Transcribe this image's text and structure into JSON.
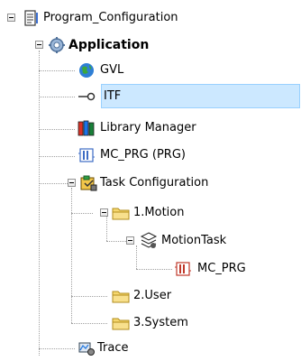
{
  "tree": {
    "root": {
      "label": "Program_Configuration"
    },
    "application": {
      "label": "Application"
    },
    "gvl": {
      "label": "GVL"
    },
    "itf": {
      "label": "ITF"
    },
    "library_manager": {
      "label": "Library Manager"
    },
    "mc_prg_prg": {
      "label": "MC_PRG (PRG)"
    },
    "task_configuration": {
      "label": "Task Configuration"
    },
    "motion_folder": {
      "label": "1.Motion"
    },
    "motion_task": {
      "label": "MotionTask"
    },
    "mc_prg_call": {
      "label": "MC_PRG"
    },
    "user_folder": {
      "label": "2.User"
    },
    "system_folder": {
      "label": "3.System"
    },
    "trace": {
      "label": "Trace"
    },
    "selected": "ITF"
  },
  "colors": {
    "selection_fill": "#cce8ff",
    "selection_border": "#99d1ff",
    "folder_yellow": "#f5d76e"
  }
}
